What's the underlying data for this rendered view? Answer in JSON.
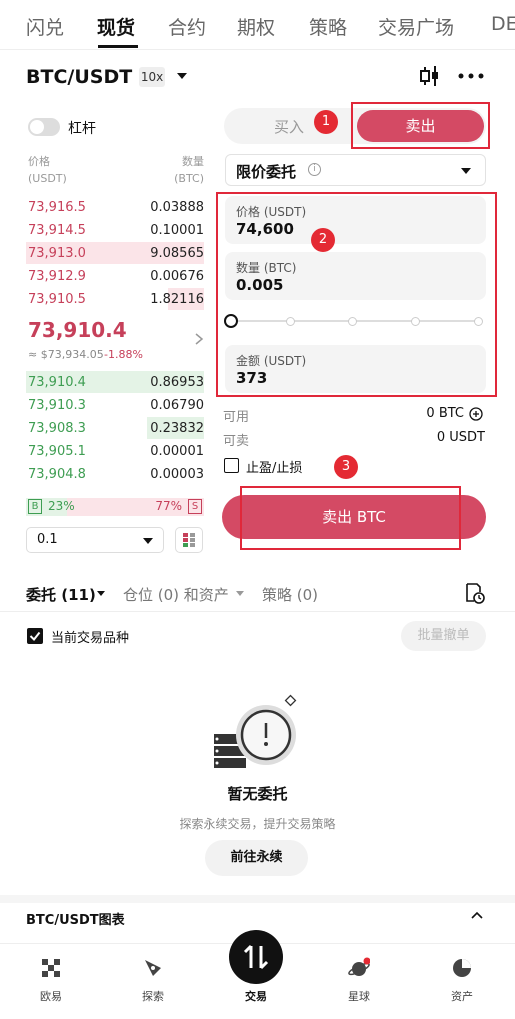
{
  "top_nav": {
    "tabs": [
      "闪兑",
      "现货",
      "合约",
      "期权",
      "策略",
      "交易广场",
      "DE"
    ],
    "active": "现货"
  },
  "header": {
    "pair": "BTC/USDT",
    "leverage": "10x"
  },
  "margin_toggle_label": "杠杆",
  "orderbook": {
    "price_header": "价格\n(USDT)",
    "qty_header": "数量\n(BTC)",
    "asks": [
      {
        "price": "73,916.5",
        "qty": "0.03888",
        "depth": 0
      },
      {
        "price": "73,914.5",
        "qty": "0.10001",
        "depth": 0
      },
      {
        "price": "73,913.0",
        "qty": "9.08565",
        "depth": 1
      },
      {
        "price": "73,912.9",
        "qty": "0.00676",
        "depth": 0
      },
      {
        "price": "73,910.5",
        "qty": "1.82116",
        "depth": 0.2
      }
    ],
    "last_price": "73,910.4",
    "ref_price": "≈ $73,934.05",
    "change": "-1.88%",
    "bids": [
      {
        "price": "73,910.4",
        "qty": "0.86953",
        "depth": 1
      },
      {
        "price": "73,910.3",
        "qty": "0.06790",
        "depth": 0
      },
      {
        "price": "73,908.3",
        "qty": "0.23832",
        "depth": 0.32
      },
      {
        "price": "73,905.1",
        "qty": "0.00001",
        "depth": 0
      },
      {
        "price": "73,904.8",
        "qty": "0.00003",
        "depth": 0
      }
    ],
    "buy_pct": "23%",
    "sell_pct": "77%",
    "buy_tag": "B",
    "sell_tag": "S",
    "buy_fraction": 0.23,
    "precision": "0.1"
  },
  "order_form": {
    "buy_tab": "买入",
    "sell_tab": "卖出",
    "order_type": "限价委托",
    "price_label": "价格 (USDT)",
    "price_value": "74,600",
    "amount_label": "数量 (BTC)",
    "amount_value": "0.005",
    "total_label": "金额 (USDT)",
    "total_value": "373",
    "available_label": "可用",
    "available_value": "0 BTC",
    "sellable_label": "可卖",
    "sellable_value": "0 USDT",
    "tpsl_label": "止盈/止损",
    "submit_label": "卖出 BTC",
    "slider_fraction": 0
  },
  "annotations": [
    "1",
    "2",
    "3"
  ],
  "orders_tabs": {
    "orders": "委托 (11)",
    "positions": "仓位 (0) 和资产",
    "strategies": "策略 (0)"
  },
  "filter": {
    "current_pair_label": "当前交易品种",
    "batch_cancel": "批量撤单"
  },
  "empty_state": {
    "title": "暂无委托",
    "subtitle": "探索永续交易，提升交易策略",
    "button": "前往永续"
  },
  "chart_section": {
    "title": "BTC/USDT图表"
  },
  "bottom_nav": {
    "items": [
      "欧易",
      "探索",
      "交易",
      "星球",
      "资产"
    ],
    "active": "交易"
  },
  "colors": {
    "ask": "#c6405a",
    "bid": "#3e9d52",
    "sell_button": "#d44a64",
    "annotation": "#e0283a"
  }
}
